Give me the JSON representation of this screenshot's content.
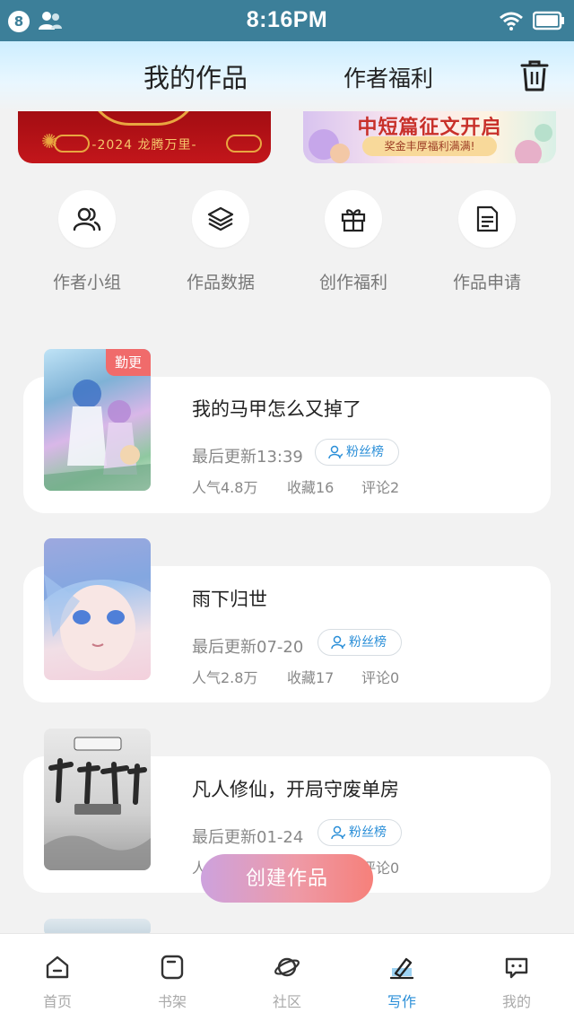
{
  "status_bar": {
    "notification_count": "8",
    "time": "8:16PM"
  },
  "header": {
    "tab_works": "我的作品",
    "tab_benefits": "作者福利"
  },
  "banners": {
    "left": {
      "text": "-2024 龙腾万里-"
    },
    "right": {
      "title": "中短篇征文开启",
      "subtitle": "奖金丰厚福利满满!"
    }
  },
  "quick_actions": [
    {
      "label": "作者小组",
      "icon": "group-icon"
    },
    {
      "label": "作品数据",
      "icon": "layers-icon"
    },
    {
      "label": "创作福利",
      "icon": "gift-icon"
    },
    {
      "label": "作品申请",
      "icon": "document-icon"
    }
  ],
  "books": [
    {
      "title": "我的马甲怎么又掉了",
      "updated": "最后更新13:39",
      "fans_label": "粉丝榜",
      "popularity": "人气4.8万",
      "favorites": "收藏16",
      "comments": "评论2",
      "badge": "勤更"
    },
    {
      "title": "雨下归世",
      "updated": "最后更新07-20",
      "fans_label": "粉丝榜",
      "popularity": "人气2.8万",
      "favorites": "收藏17",
      "comments": "评论0"
    },
    {
      "title": "凡人修仙，开局守废单房",
      "updated": "最后更新01-24",
      "fans_label": "粉丝榜",
      "popularity": "人",
      "favorites": "",
      "comments": "评论0"
    }
  ],
  "create_button": "创建作品",
  "bottom_nav": [
    {
      "label": "首页",
      "icon": "home-icon"
    },
    {
      "label": "书架",
      "icon": "bookshelf-icon"
    },
    {
      "label": "社区",
      "icon": "planet-icon"
    },
    {
      "label": "写作",
      "icon": "pen-icon",
      "active": true
    },
    {
      "label": "我的",
      "icon": "chat-icon"
    }
  ],
  "colors": {
    "accent": "#2b8fd8",
    "status_bar": "#3c7f99",
    "badge": "#f06b6b"
  }
}
